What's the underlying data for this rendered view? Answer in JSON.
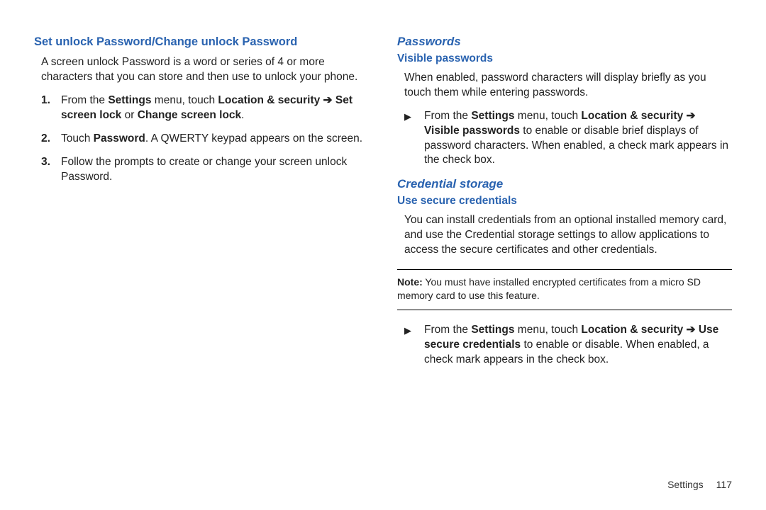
{
  "left": {
    "heading": "Set unlock Password/Change unlock Password",
    "intro": "A screen unlock Password is a word or series of 4 or more characters that you can store and then use to unlock your phone.",
    "step1_pre": "From the ",
    "step1_b1": "Settings",
    "step1_mid1": " menu, touch ",
    "step1_b2": "Location & security",
    "step1_arrow": " ➔ ",
    "step1_b3": "Set screen lock",
    "step1_or": " or ",
    "step1_b4": "Change screen lock",
    "step1_end": ".",
    "step2_pre": "Touch ",
    "step2_b1": "Password",
    "step2_post": ". A QWERTY keypad appears on the screen.",
    "step3": "Follow the prompts to create or change your screen unlock Password."
  },
  "right": {
    "passwords_heading": "Passwords",
    "visible_heading": "Visible passwords",
    "visible_intro": "When enabled, password characters will display briefly as you touch them while entering passwords.",
    "vp_pre": "From the ",
    "vp_b1": "Settings",
    "vp_mid1": " menu, touch ",
    "vp_b2": "Location & security",
    "vp_arrow": " ➔ ",
    "vp_b3": "Visible passwords",
    "vp_post": " to enable or disable brief displays of password characters. When enabled, a check mark appears in the check box.",
    "cred_heading": "Credential storage",
    "use_secure_heading": "Use secure credentials",
    "cred_intro": "You can install credentials from an optional installed memory card, and use the Credential storage settings to allow applications to access the secure certificates and other credentials.",
    "note_label": "Note:",
    "note_text": " You must have installed encrypted certificates from a micro SD memory card to use this feature.",
    "uc_pre": "From the ",
    "uc_b1": "Settings",
    "uc_mid1": " menu, touch ",
    "uc_b2": "Location & security",
    "uc_arrow": " ➔ ",
    "uc_b3": "Use secure credentials",
    "uc_post": " to enable or disable. When enabled, a check mark appears in the check box."
  },
  "footer": {
    "section": "Settings",
    "page": "117"
  }
}
